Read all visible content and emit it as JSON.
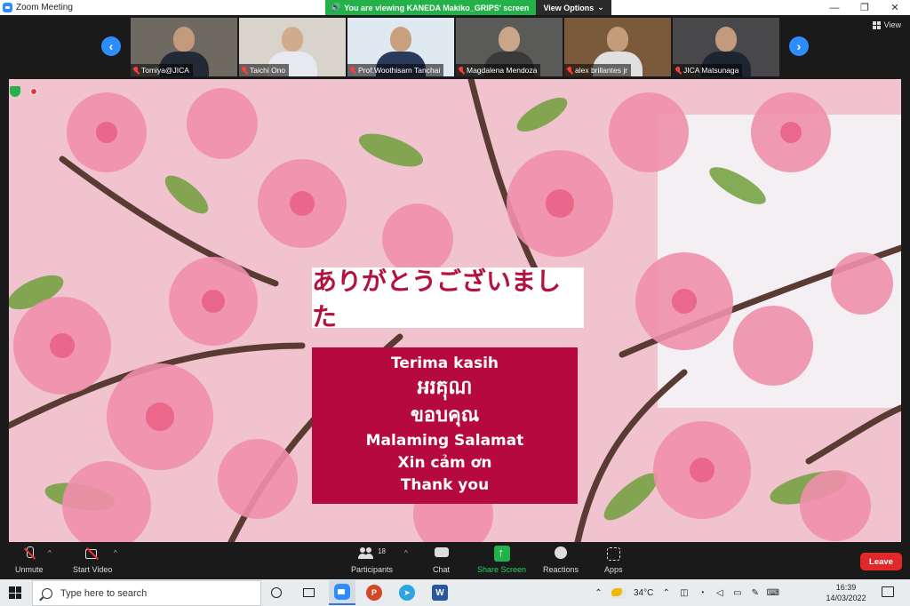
{
  "window": {
    "title": "Zoom Meeting",
    "controls": {
      "minimize": "—",
      "restore": "❐",
      "close": "✕"
    }
  },
  "banner": {
    "viewing_text": "You are viewing KANEDA Makiko_GRIPS' screen",
    "options_label": "View Options"
  },
  "gallery": {
    "view_label": "View",
    "prev_arrow": "‹",
    "next_arrow": "›",
    "participants": [
      {
        "name": "Tomiya@JICA",
        "bg": "#6e6a62",
        "face": "#c49a7c",
        "suit": "#222a36"
      },
      {
        "name": "Taichi Ono",
        "bg": "#d8d4cc",
        "face": "#d2ab8c",
        "suit": "#e8e8f0"
      },
      {
        "name": "Prof.Woothisarn Tanchai",
        "bg": "#dfe9f2",
        "face": "#c9a07e",
        "suit": "#2a3a5c"
      },
      {
        "name": "Magdalena Mendoza",
        "bg": "#5a5a58",
        "face": "#c9a58a",
        "suit": "#3a3a3a"
      },
      {
        "name": "alex brillantes jr",
        "bg": "#7a5a3a",
        "face": "#c59c7a",
        "suit": "#e0e0e0"
      },
      {
        "name": "JICA Matsunaga",
        "bg": "#48484a",
        "face": "#c29a7e",
        "suit": "#1e2430"
      }
    ]
  },
  "slide": {
    "japanese": "ありがとうございました",
    "lines": [
      "Terima kasih",
      "អរគុណ",
      "ขอบคุณ",
      "Malaming Salamat",
      "Xin cảm ơn",
      "Thank you"
    ],
    "colors": {
      "accent": "#b5093f",
      "jp_text": "#b3123f"
    }
  },
  "toolbar": {
    "unmute_label": "Unmute",
    "start_video_label": "Start Video",
    "participants_label": "Participants",
    "participants_count": "18",
    "chat_label": "Chat",
    "share_screen_label": "Share Screen",
    "reactions_label": "Reactions",
    "apps_label": "Apps",
    "leave_label": "Leave"
  },
  "taskbar": {
    "search_placeholder": "Type here to search",
    "ppt_letter": "P",
    "telegram_symbol": "➤",
    "word_letter": "W",
    "temperature": "34°C",
    "time": "16:39",
    "date": "14/03/2022"
  }
}
